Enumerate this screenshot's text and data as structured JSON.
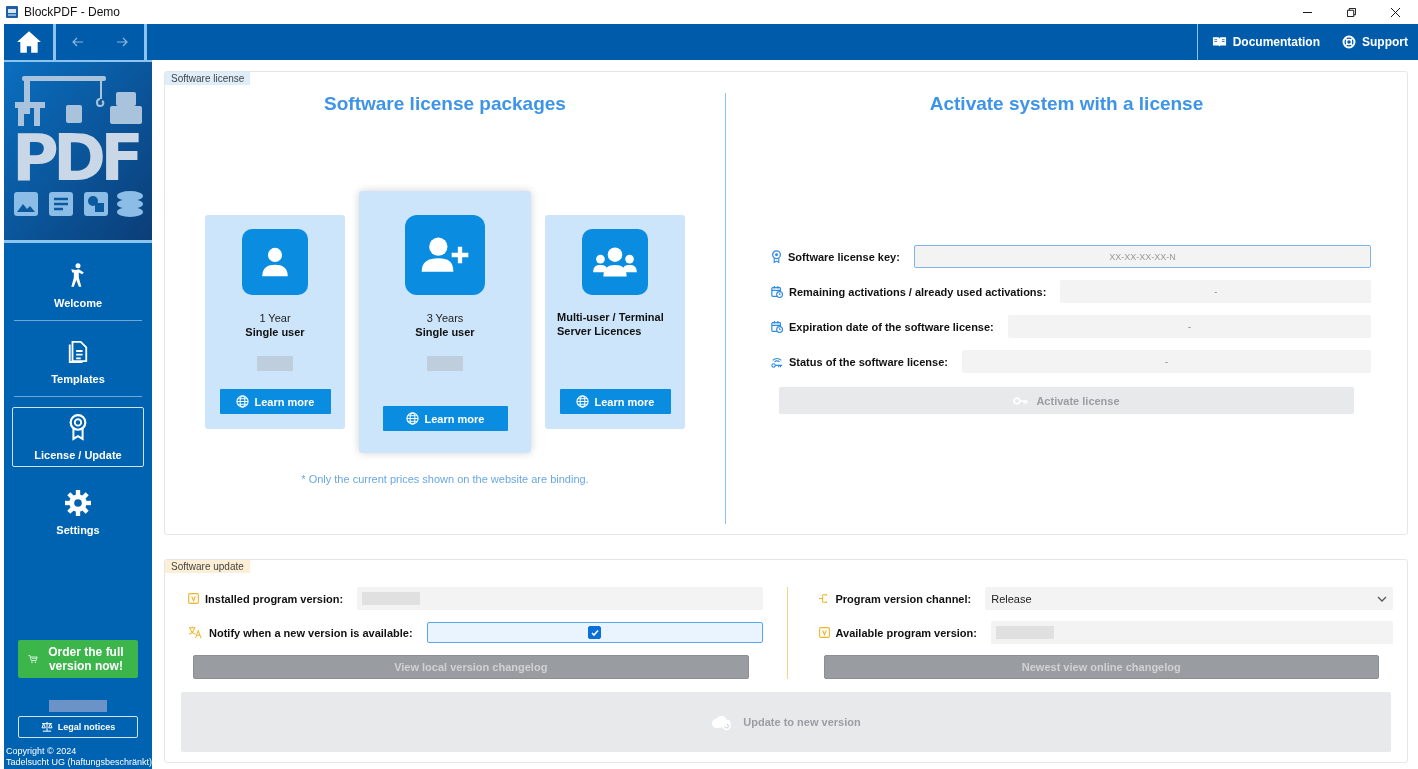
{
  "window": {
    "title": "BlockPDF - Demo"
  },
  "toolbar": {
    "links": [
      {
        "label": "Documentation",
        "kind": "book"
      },
      {
        "label": "Support",
        "kind": "lifebuoy"
      }
    ]
  },
  "sidebar": {
    "logo_text": "PDF",
    "items": [
      {
        "label": "Welcome",
        "selected": false
      },
      {
        "label": "Templates",
        "selected": false
      },
      {
        "label": "License / Update",
        "selected": true
      },
      {
        "label": "Settings",
        "selected": false
      }
    ],
    "order_button": "Order the full version now!",
    "version_blurred": true,
    "legal_button": "Legal notices",
    "copyright": [
      "Copyright © 2024",
      "Tadelsucht UG (haftungsbeschränkt)"
    ]
  },
  "license_panel": {
    "tag": "Software license",
    "packages_title": "Software license packages",
    "packages": [
      {
        "line_1": "1 Year",
        "line_2": "Single user",
        "price_blurred": true,
        "featured": false,
        "kind": "user",
        "button": "Learn more"
      },
      {
        "line_1": "3 Years",
        "line_2": "Single user",
        "price_blurred": true,
        "featured": true,
        "kind": "user-plus",
        "button": "Learn more"
      },
      {
        "line_1": "Multi-user / Terminal Server Licences",
        "price_blurred": false,
        "featured": false,
        "kind": "users",
        "button": "Learn more"
      }
    ],
    "note": "* Only the current prices shown on the website are binding.",
    "activation_title": "Activate system with a license",
    "fields": [
      {
        "label": "Software license key:",
        "kind": "input",
        "placeholder": "XX-XX-XX-XX-N"
      },
      {
        "label": "Remaining activations / already used activations:",
        "kind": "readout",
        "value": "-"
      },
      {
        "label": "Expiration date of the software license:",
        "kind": "readout",
        "value": "-"
      },
      {
        "label": "Status of the software license:",
        "kind": "readout",
        "value": "-"
      }
    ],
    "activate_button": {
      "label": "Activate license",
      "disabled": true
    }
  },
  "update_panel": {
    "tag": "Software update",
    "left": {
      "installed_label": "Installed program version:",
      "installed_blurred": true,
      "notify_label": "Notify when a new version is available:",
      "notify_checked": true,
      "button": {
        "label": "View local version changelog",
        "disabled": true
      }
    },
    "right": {
      "channel_label": "Program version channel:",
      "channel_value": "Release",
      "available_label": "Available program version:",
      "available_blurred": true,
      "button": {
        "label": "Newest view online changelog",
        "disabled": true
      }
    },
    "update_button": {
      "label": "Update to new version",
      "disabled": true
    }
  }
}
